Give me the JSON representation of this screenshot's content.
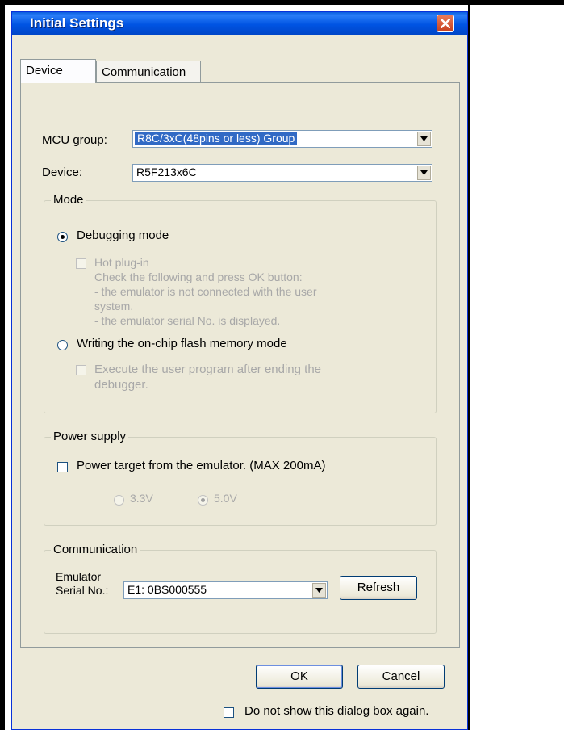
{
  "window": {
    "title": "Initial Settings"
  },
  "tabs": [
    {
      "label": "Device",
      "active": true
    },
    {
      "label": "Communication",
      "active": false
    }
  ],
  "device_tab": {
    "mcu_group_label": "MCU group:",
    "mcu_group_value": "R8C/3xC(48pins or less) Group",
    "device_label": "Device:",
    "device_value": "R5F213x6C",
    "mode": {
      "title": "Mode",
      "debugging_mode_label": "Debugging mode",
      "debugging_mode_selected": true,
      "hot_plugin_label": "Hot plug-in",
      "hot_plugin_info": [
        "Check the following and press OK button:",
        "- the emulator is not connected with the user",
        "system.",
        "- the emulator serial No. is displayed."
      ],
      "writing_mode_label": "Writing the on-chip flash memory mode",
      "writing_mode_selected": false,
      "execute_label_line1": "Execute the user program after ending the",
      "execute_label_line2": "debugger."
    },
    "power_supply": {
      "title": "Power supply",
      "power_target_label": "Power target from the emulator. (MAX 200mA)",
      "power_target_checked": false,
      "voltage_options": [
        {
          "label": "3.3V",
          "selected": false
        },
        {
          "label": "5.0V",
          "selected": true
        }
      ]
    },
    "communication": {
      "title": "Communication",
      "serial_label_line1": "Emulator",
      "serial_label_line2": "Serial No.:",
      "serial_value": "E1: 0BS000555",
      "refresh_label": "Refresh"
    }
  },
  "buttons": {
    "ok_label": "OK",
    "cancel_label": "Cancel"
  },
  "footer": {
    "do_not_show_label": "Do not show this dialog box again.",
    "do_not_show_checked": false
  },
  "colors": {
    "titlebar": "#0054e3",
    "dialog_bg": "#ece9d8",
    "selection": "#316ac5",
    "disabled_text": "#a8a8a8"
  }
}
